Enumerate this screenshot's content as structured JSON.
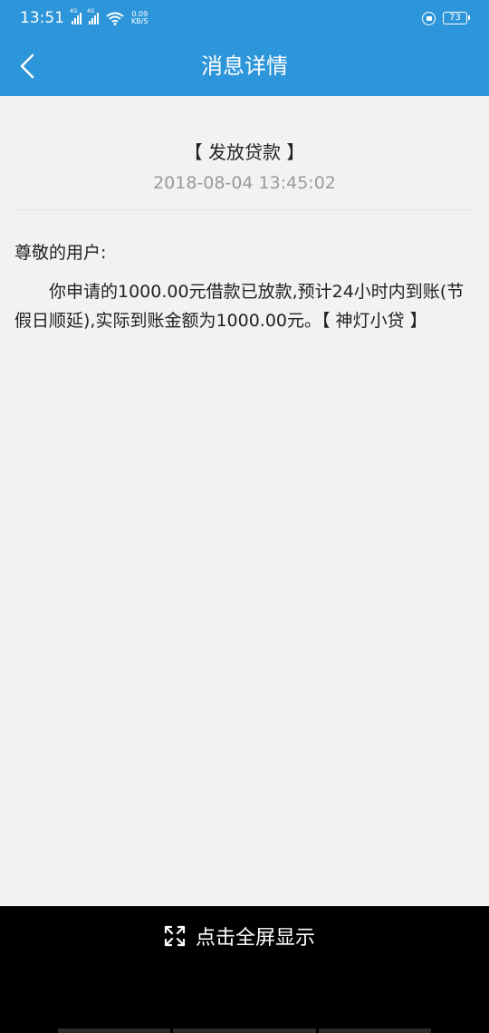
{
  "status_bar": {
    "time": "13:51",
    "network_tags": [
      "4G",
      "4G"
    ],
    "speed_value": "0.09",
    "speed_unit": "KB/S",
    "battery": "73"
  },
  "header": {
    "title": "消息详情",
    "back_icon": "chevron-left-icon"
  },
  "message": {
    "title": "【 发放贷款 】",
    "time": "2018-08-04 13:45:02",
    "greeting": "尊敬的用户:",
    "body": "你申请的1000.00元借款已放款,预计24小时内到账(节假日顺延),实际到账金额为1000.00元。【 神灯小贷 】"
  },
  "bottom_bar": {
    "fullscreen_label": "点击全屏显示",
    "fullscreen_icon": "expand-icon"
  },
  "colors": {
    "primary": "#2d95d9",
    "background": "#f2f2f2",
    "bottom_bar": "#000000"
  }
}
